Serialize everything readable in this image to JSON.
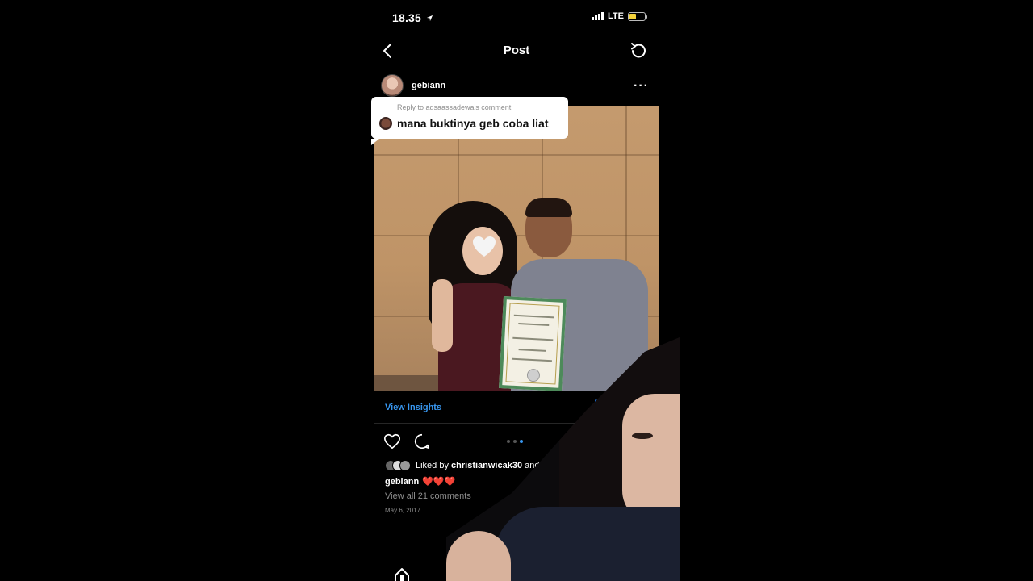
{
  "status_bar": {
    "time": "18.35",
    "network": "LTE"
  },
  "nav": {
    "title": "Post"
  },
  "post": {
    "username": "gebiann",
    "reply": {
      "label": "Reply to aqsaassadewa's comment",
      "text": "mana buktinya geb coba liat"
    },
    "insights_label": "View Insights",
    "liked_prefix": "Liked by ",
    "liked_user": "christianwicak30",
    "liked_suffix": " and 1.466",
    "caption_user": "gebiann",
    "caption_text": "❤️❤️❤️",
    "view_comments": "View all 21 comments",
    "date": "May 6, 2017",
    "pager": {
      "count": 3,
      "active": 3
    }
  },
  "colors": {
    "accent": "#3897f0",
    "background": "#000000",
    "muted": "#8e8e8e"
  },
  "icons": {
    "back": "chevron-left-icon",
    "refresh": "refresh-icon",
    "more": "more-dots-icon",
    "like": "heart-icon",
    "comment": "comment-icon",
    "home": "home-icon"
  }
}
